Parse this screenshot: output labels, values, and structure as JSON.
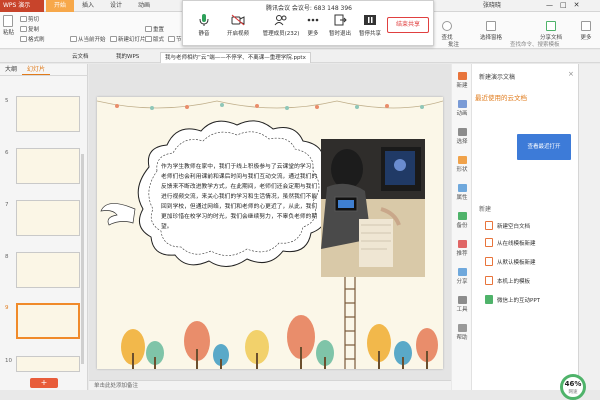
{
  "app": {
    "logo": "WPS 演示",
    "tabs": [
      "开始",
      "插入",
      "设计",
      "动画"
    ],
    "active_tab": "开始",
    "user": "张晓晓",
    "controls": [
      "—",
      "□",
      "✕"
    ]
  },
  "ribbon": {
    "paste": "粘贴",
    "cut": "剪切",
    "copy": "复制",
    "format_painter": "格式刷",
    "from_start": "从当前开始",
    "new_slide": "新建幻灯片",
    "layout": "版式",
    "reset": "重置",
    "section": "节",
    "find": "查找",
    "select_window": "选择窗格",
    "share_doc": "分享文档",
    "more": "更多",
    "comment": "批注",
    "search_placeholder": "查找命令、搜索模板"
  },
  "meeting": {
    "title": "腾讯会议 会议号: 683 148 396",
    "buttons": [
      {
        "label": "静音",
        "icon": "microphone-icon"
      },
      {
        "label": "开启视频",
        "icon": "camera-off-icon"
      },
      {
        "label": "管理成员(232)",
        "icon": "members-icon"
      },
      {
        "label": "更多",
        "icon": "more-icon"
      },
      {
        "label": "暂时退出",
        "icon": "exit-icon"
      },
      {
        "label": "暂停共享",
        "icon": "pause-icon"
      }
    ],
    "end_share": "结束共享"
  },
  "doctabs": [
    {
      "label": "云文档",
      "active": false
    },
    {
      "label": "我的WPS",
      "active": false
    },
    {
      "label": "我与老师相约“云”端——不停学、不离课—重理学院.pptx",
      "active": true
    }
  ],
  "left_panel": {
    "tabs": [
      "大纲",
      "幻灯片"
    ],
    "active_tab": "幻灯片",
    "slide_numbers": [
      "5",
      "6",
      "7",
      "8",
      "9",
      "10"
    ],
    "selected": "9",
    "add_label": "+"
  },
  "slide": {
    "body": "作为学生教师在家中，我们于线上积极参与了云课堂的学习，老师们也会利用课前和课后时间与我们互动交流，通过我们的反馈来不断改进教学方式，在此期间，老师们还会定期与我们进行视频交流，来关心我们的学习和生活情况，虽然我们不能回到学校，但通过网络，我们和老师的心更近了，从此，我们更加珍惜在校学习的时光，我们会继续努力，不辜负老师的期望。"
  },
  "notes": "单击此处添加备注",
  "right_panel": {
    "header": "新建演示文稿",
    "close": "×",
    "recent": "最近使用的云文档",
    "view_recent": "查看最近打开",
    "new": "新建",
    "items": [
      {
        "label": "新建空白文档",
        "color": "#e8743b"
      },
      {
        "label": "从在线模板新建",
        "color": "#e8743b"
      },
      {
        "label": "从默认模板新建",
        "color": "#e8743b"
      },
      {
        "label": "本机上的模板",
        "color": "#e8743b"
      },
      {
        "label": "微信上的互动PPT",
        "color": "#4fb36a"
      }
    ]
  },
  "right_tools": [
    {
      "label": "新建",
      "color": "#e8743b"
    },
    {
      "label": "动画",
      "color": "#7a9bd6"
    },
    {
      "label": "选择",
      "color": "#8c8c8c"
    },
    {
      "label": "形状",
      "color": "#f0a24a"
    },
    {
      "label": "属性",
      "color": "#6fa8dc"
    },
    {
      "label": "备份",
      "color": "#4fb36a"
    },
    {
      "label": "推荐",
      "color": "#e06666"
    },
    {
      "label": "分享",
      "color": "#6fa8dc"
    },
    {
      "label": "工具",
      "color": "#8c8c8c"
    },
    {
      "label": "帮助",
      "color": "#999999"
    }
  ],
  "progress": {
    "value": "46%",
    "unit": "网速"
  }
}
